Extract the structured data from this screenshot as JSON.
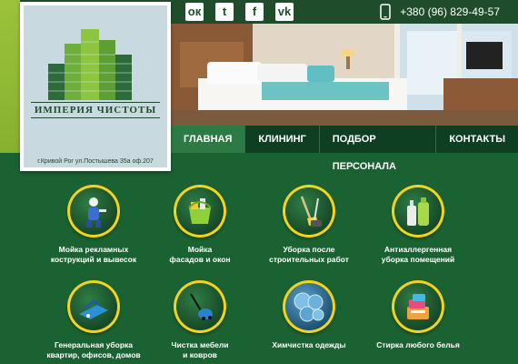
{
  "brand": {
    "name": "ИМПЕРИЯ ЧИСТОТЫ",
    "address": "г.Кривой Рог ул.Постышева 35а оф.207"
  },
  "colors": {
    "bg_green": "#1b6233",
    "nav_dark": "#0f3f22",
    "nav_active": "#2d7a45",
    "accent_yellow": "#f1d41b",
    "lime": "#9cc23c"
  },
  "socials": [
    {
      "icon": "odnoklassniki-icon",
      "glyph": "ок"
    },
    {
      "icon": "twitter-icon",
      "glyph": "t"
    },
    {
      "icon": "facebook-icon",
      "glyph": "f"
    },
    {
      "icon": "vk-icon",
      "glyph": "vk"
    }
  ],
  "contact": {
    "phone": "+380 (96) 829-49-57",
    "phone_icon": "phone-icon"
  },
  "nav": [
    {
      "label": "ГЛАВНАЯ",
      "active": true
    },
    {
      "label": "КЛИНИНГ",
      "active": false
    },
    {
      "label": "ПОДБОР ПЕРСОНАЛА",
      "active": false
    },
    {
      "label": "КОНТАКТЫ",
      "active": false
    }
  ],
  "services": [
    {
      "label": "Мойка рекламных\nкострукций и вывесок",
      "icon": "window-washer-icon"
    },
    {
      "label": "Мойка\nфасадов и окон",
      "icon": "cleaning-bucket-icon"
    },
    {
      "label": "Уборка после\nстроительных работ",
      "icon": "broom-mop-icon"
    },
    {
      "label": "Антиаллергенная\nуборка помещений",
      "icon": "detergent-bottles-icon"
    },
    {
      "label": "Генеральная уборка\nквартир, офисов, домов",
      "icon": "floor-cleaner-icon"
    },
    {
      "label": "Чистка мебели\nи ковров",
      "icon": "vacuum-cleaner-icon"
    },
    {
      "label": "Химчистка одежды",
      "icon": "soap-bubbles-icon"
    },
    {
      "label": "Стирка любого белья",
      "icon": "laundry-icon"
    }
  ]
}
